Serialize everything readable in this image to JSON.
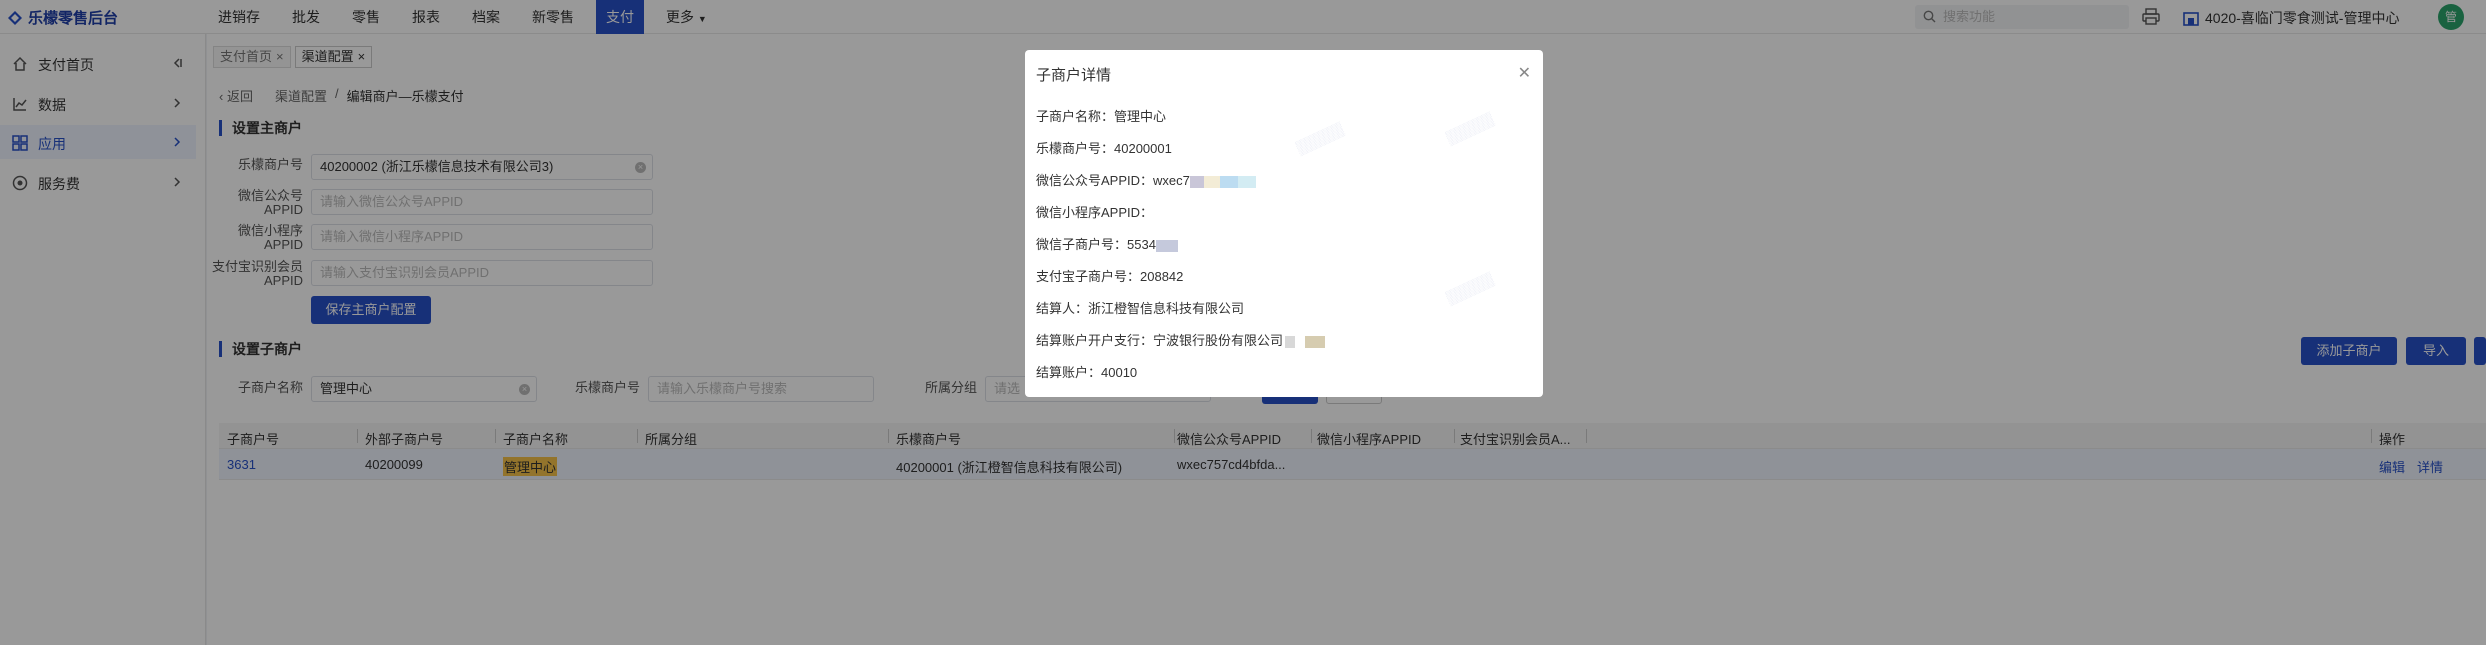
{
  "app": {
    "title": "乐檬零售后台"
  },
  "nav": [
    {
      "label": "进销存",
      "active": false
    },
    {
      "label": "批发",
      "active": false
    },
    {
      "label": "零售",
      "active": false
    },
    {
      "label": "报表",
      "active": false
    },
    {
      "label": "档案",
      "active": false
    },
    {
      "label": "新零售",
      "active": false
    },
    {
      "label": "支付",
      "active": true
    },
    {
      "label": "更多",
      "active": false
    }
  ],
  "topbar": {
    "search_placeholder": "搜索功能",
    "store_name": "4020-喜临门零食测试-管理中心",
    "avatar_text": "管"
  },
  "sidebar": [
    {
      "label": "支付首页",
      "icon": "home-icon"
    },
    {
      "label": "数据",
      "icon": "chart-icon"
    },
    {
      "label": "应用",
      "icon": "apps-icon",
      "active": true
    },
    {
      "label": "服务费",
      "icon": "service-icon"
    }
  ],
  "tabs": [
    {
      "label": "支付首页",
      "active": false
    },
    {
      "label": "渠道配置",
      "active": true
    }
  ],
  "breadcrumb": {
    "back": "返回",
    "parent": "渠道配置",
    "sep": "/",
    "current": "编辑商户—乐檬支付"
  },
  "main_merchant": {
    "title": "设置主商户",
    "fields": [
      {
        "label": "乐檬商户号",
        "value": "40200002 (浙江乐檬信息技术有限公司3)",
        "placeholder": ""
      },
      {
        "label": "微信公众号APPID",
        "value": "",
        "placeholder": "请输入微信公众号APPID"
      },
      {
        "label": "微信小程序APPID",
        "value": "",
        "placeholder": "请输入微信小程序APPID"
      },
      {
        "label": "支付宝识别会员APPID",
        "value": "",
        "placeholder": "请输入支付宝识别会员APPID"
      }
    ],
    "save_label": "保存主商户配置"
  },
  "sub_merchant": {
    "title": "设置子商户",
    "filters": {
      "name_label": "子商户名称",
      "name_value": "管理中心",
      "lemeng_label": "乐檬商户号",
      "lemeng_placeholder": "请输入乐檬商户号搜索",
      "group_label": "所属分组",
      "group_placeholder": "请选"
    },
    "add_label": "添加子商户",
    "import_label": "导入"
  },
  "table": {
    "headers": [
      "子商户号",
      "外部子商户号",
      "子商户名称",
      "所属分组",
      "乐檬商户号",
      "微信公众号APPID",
      "微信小程序APPID",
      "支付宝识别会员A...",
      "操作"
    ],
    "rows": [
      {
        "id": "3631",
        "external_id": "40200099",
        "name": "管理中心",
        "group": "",
        "lemeng_id": "40200001 (浙江橙智信息科技有限公司)",
        "wechat_appid": "wxec757cd4bfda...",
        "mini_appid": "",
        "alipay_appid": "",
        "edit_label": "编辑",
        "detail_label": "详情"
      }
    ]
  },
  "modal": {
    "title": "子商户详情",
    "rows": [
      {
        "label": "子商户名称：",
        "value": "管理中心"
      },
      {
        "label": "乐檬商户号：",
        "value": "40200001"
      },
      {
        "label": "微信公众号APPID：",
        "value": "wxec7"
      },
      {
        "label": "微信小程序APPID：",
        "value": ""
      },
      {
        "label": "微信子商户号：",
        "value": "5534"
      },
      {
        "label": "支付宝子商户号：",
        "value": "208842"
      },
      {
        "label": "结算人：",
        "value": "浙江橙智信息科技有限公司"
      },
      {
        "label": "结算账户开户支行：",
        "value": "宁波银行股份有限公司"
      },
      {
        "label": "结算账户：",
        "value": "40010"
      }
    ]
  },
  "colors": {
    "primary": "#2750c9",
    "highlight": "#f5c24a"
  }
}
